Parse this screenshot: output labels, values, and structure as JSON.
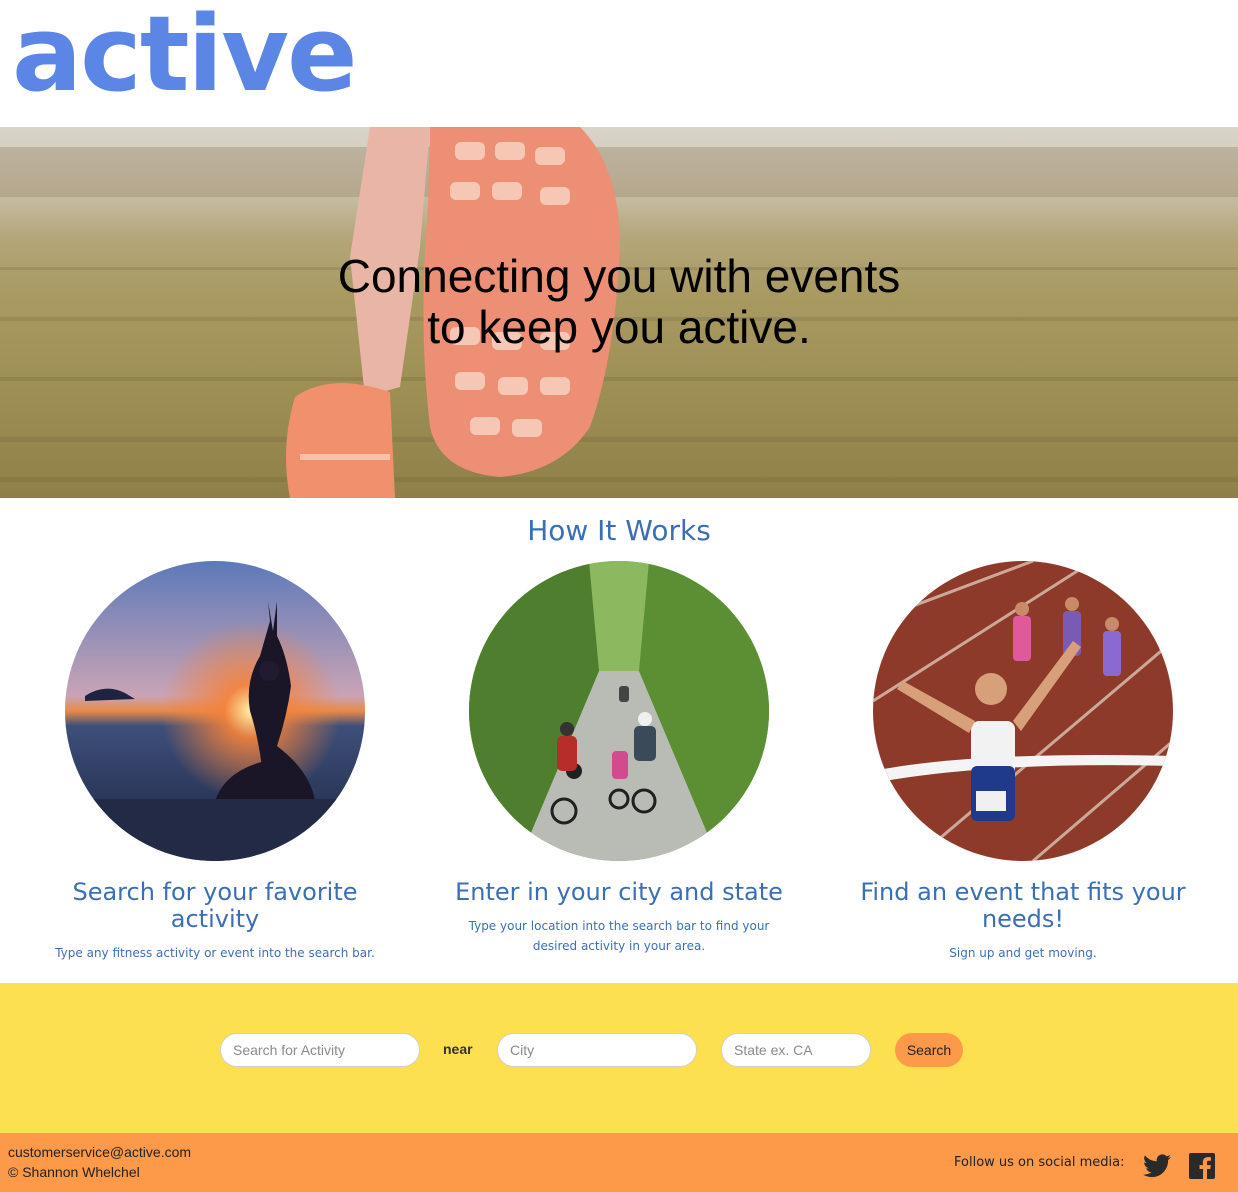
{
  "header": {
    "logo_text": "active"
  },
  "hero": {
    "line1": "Connecting you with events",
    "line2": "to keep you active."
  },
  "how_it_works": {
    "title": "How It Works",
    "steps": [
      {
        "title": "Search for your favorite activity",
        "description": "Type any fitness activity or event into the search bar."
      },
      {
        "title": "Enter in your city and state",
        "description": "Type your location into the search bar to find your desired activity in your area."
      },
      {
        "title": "Find an event that fits your needs!",
        "description": "Sign up and get moving."
      }
    ]
  },
  "search": {
    "activity_placeholder": "Search for Activity",
    "near_label": "near",
    "city_placeholder": "City",
    "state_placeholder": "State ex. CA",
    "button_label": "Search"
  },
  "footer": {
    "email": "customerservice@active.com",
    "copyright": "© Shannon Whelchel",
    "follow_label": "Follow us on social media:",
    "icons": [
      "twitter-icon",
      "facebook-icon"
    ]
  },
  "colors": {
    "brand_blue": "#5b86e5",
    "text_blue": "#3a6fb5",
    "search_band": "#fde04f",
    "accent_orange": "#fd9a4a"
  }
}
